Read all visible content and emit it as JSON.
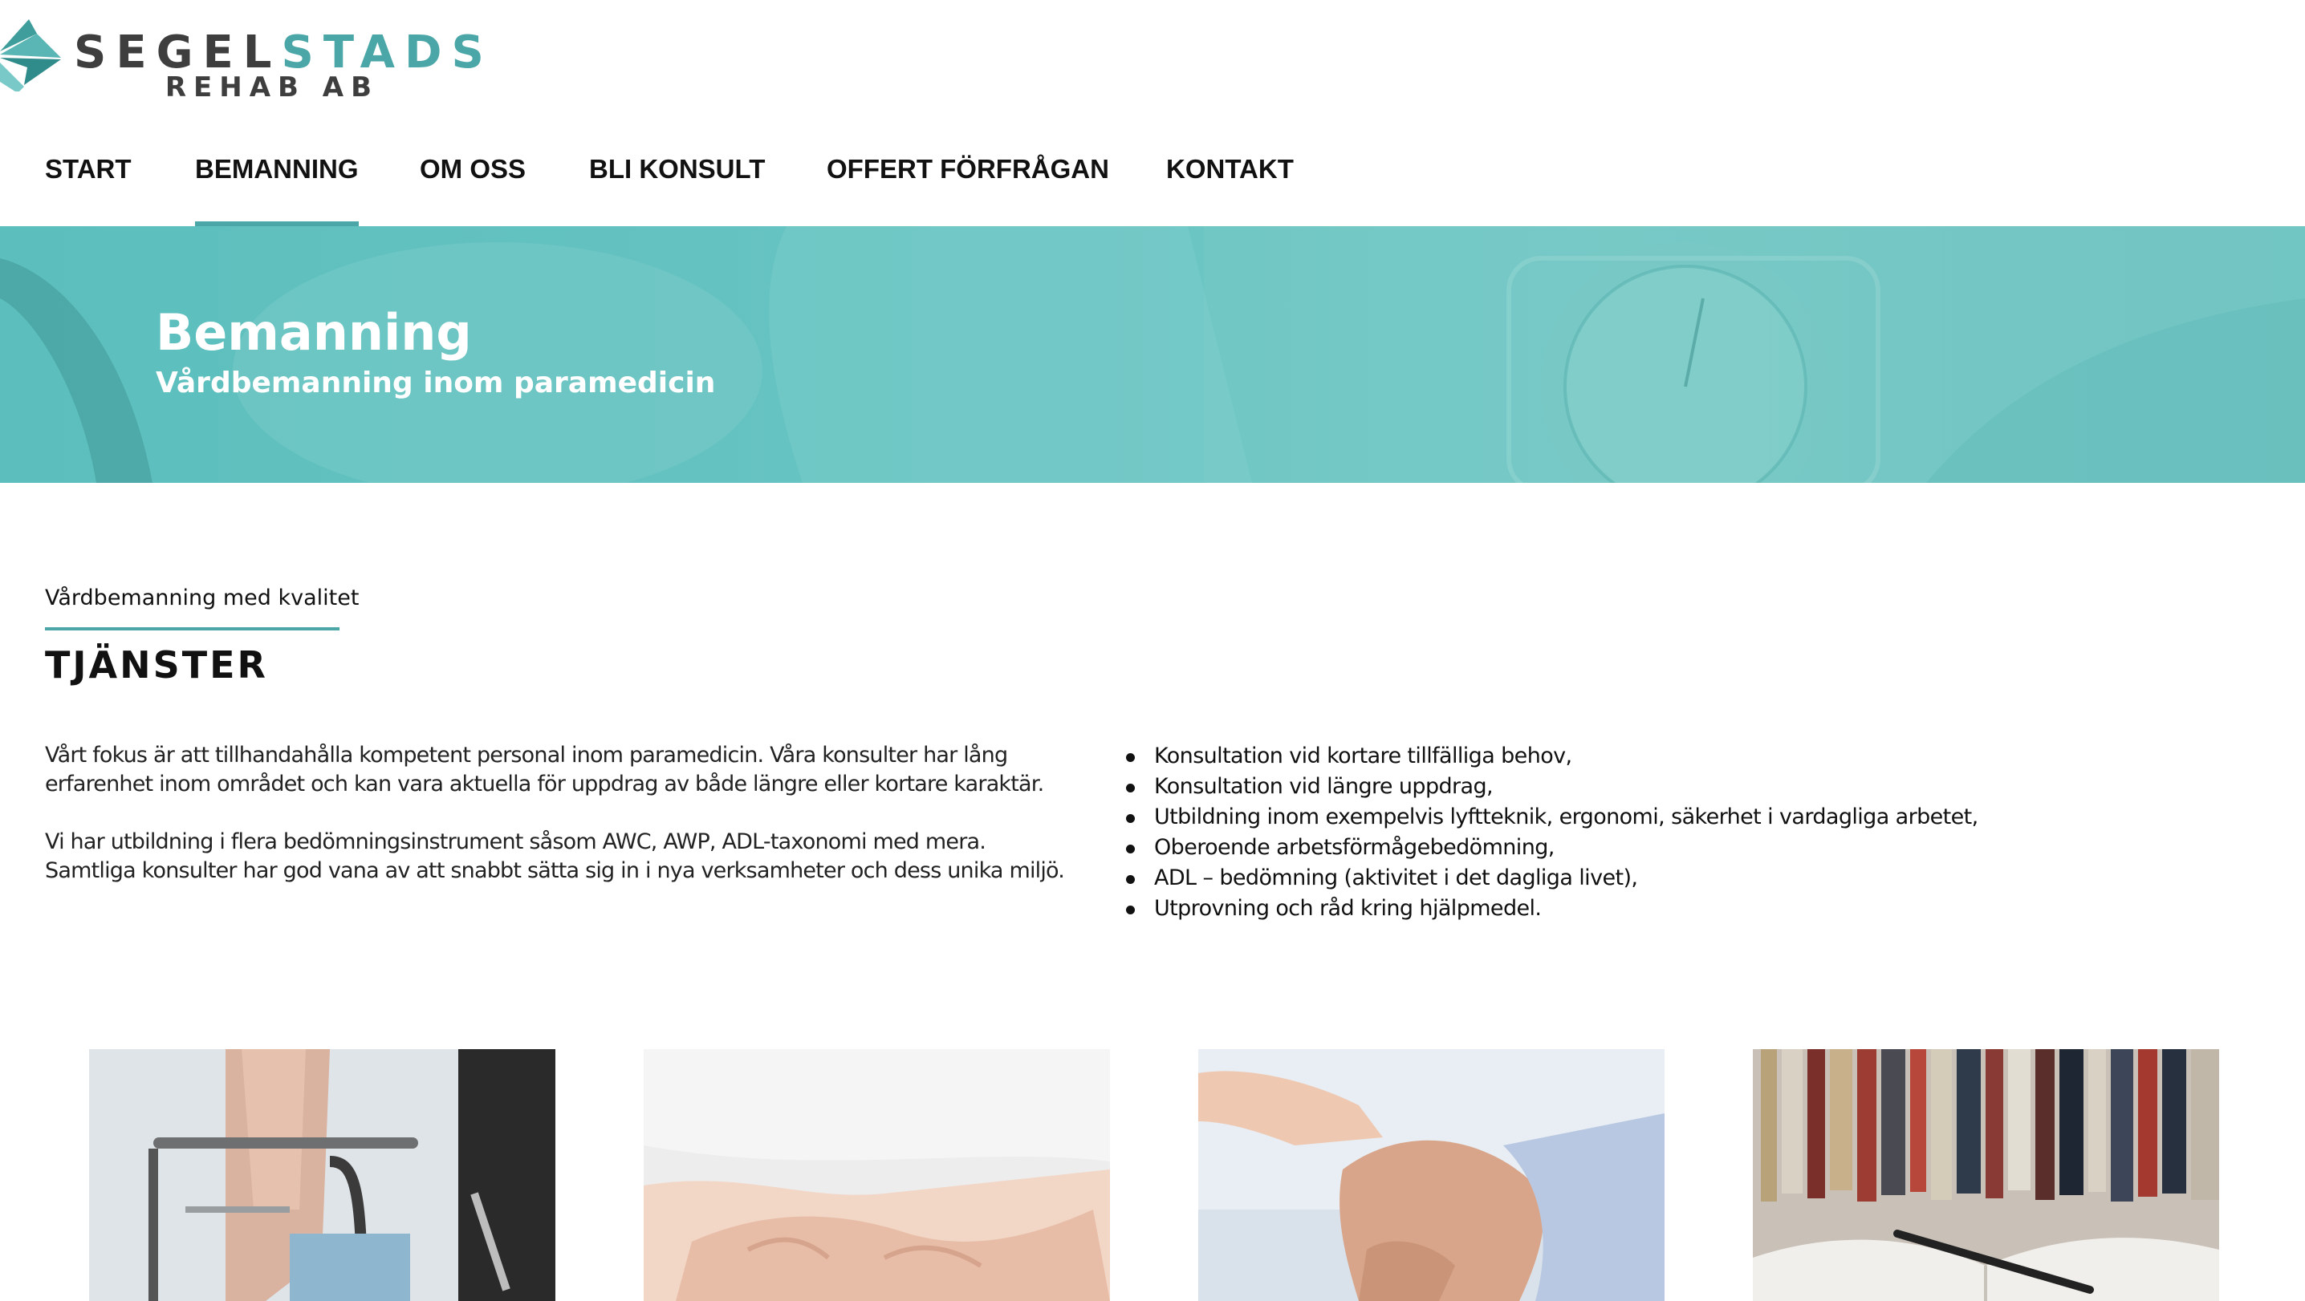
{
  "brand": {
    "wordmark_a": "SEGEL",
    "wordmark_b": "STADS",
    "subline": "REHAB AB",
    "colors": {
      "teal": "#4aa6a7",
      "dark": "#3e3e3e"
    }
  },
  "nav": {
    "items": [
      {
        "label": "START"
      },
      {
        "label": "BEMANNING",
        "active": true
      },
      {
        "label": "OM OSS"
      },
      {
        "label": "BLI KONSULT"
      },
      {
        "label": "OFFERT FÖRFRÅGAN"
      },
      {
        "label": "KONTAKT"
      }
    ]
  },
  "hero": {
    "title": "Bemanning",
    "subtitle": "Vårdbemanning inom paramedicin",
    "background_color": "#66c3c1"
  },
  "section": {
    "kicker": "Vårdbemanning med kvalitet",
    "title": "TJÄNSTER",
    "paragraphs": [
      {
        "line1": "Vårt fokus är att tillhandahålla kompetent personal inom paramedicin. Våra konsulter har lång",
        "line2": "erfarenhet inom området och kan vara aktuella för uppdrag av både längre eller kortare karaktär."
      },
      {
        "line1": "Vi har utbildning i flera bedömningsinstrument såsom AWC, AWP, ADL-taxonomi med mera.",
        "line2": "Samtliga konsulter har god vana av att snabbt sätta sig in i nya verksamheter och dess unika miljö."
      }
    ],
    "services": [
      "Konsultation vid kortare tillfälliga behov,",
      "Konsultation vid längre uppdrag,",
      "Utbildning inom exempelvis lyftteknik, ergonomi, säkerhet i vardagliga arbetet,",
      "Oberoende arbetsförmågebedömning,",
      "ADL – bedömning (aktivitet i det dagliga livet),",
      "Utprovning och råd kring hjälpmedel."
    ]
  },
  "cards": [
    {
      "icon": "wheelchair-photo"
    },
    {
      "icon": "hands-photo"
    },
    {
      "icon": "knee-treatment-photo"
    },
    {
      "icon": "book-photo"
    }
  ]
}
